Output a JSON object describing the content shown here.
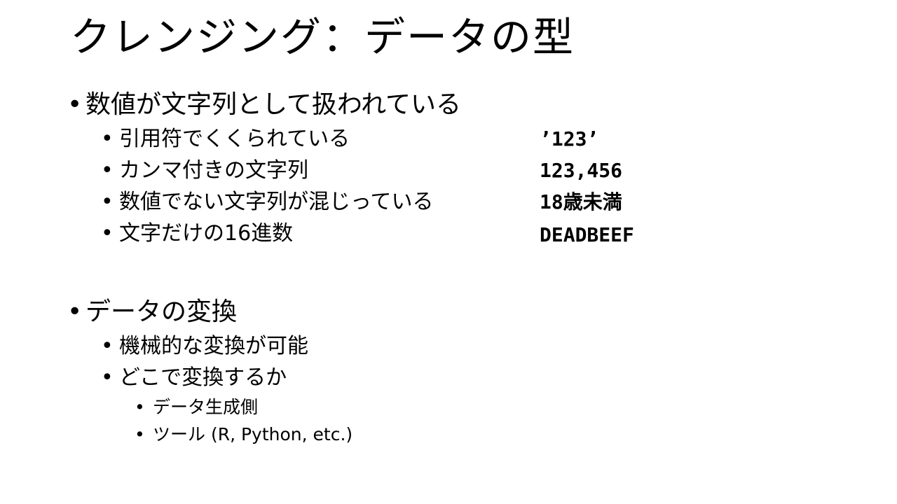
{
  "slide": {
    "title": "クレンジング：データの型",
    "section1": {
      "heading": "数値が文字列として扱われている",
      "items": [
        {
          "label": "引用符でくくられている",
          "example": "’123’"
        },
        {
          "label": "カンマ付きの文字列",
          "example": "123,456"
        },
        {
          "label": "数値でない文字列が混じっている",
          "example": "18歳未満"
        },
        {
          "label": "文字だけの16進数",
          "example": "DEADBEEF"
        }
      ]
    },
    "section2": {
      "heading": "データの変換",
      "items": [
        {
          "label": "機械的な変換が可能"
        },
        {
          "label": "どこで変換するか"
        }
      ],
      "subitems": [
        {
          "label": "データ生成側"
        },
        {
          "label": "ツール (R, Python, etc.)"
        }
      ]
    },
    "bullet_char": "•"
  }
}
